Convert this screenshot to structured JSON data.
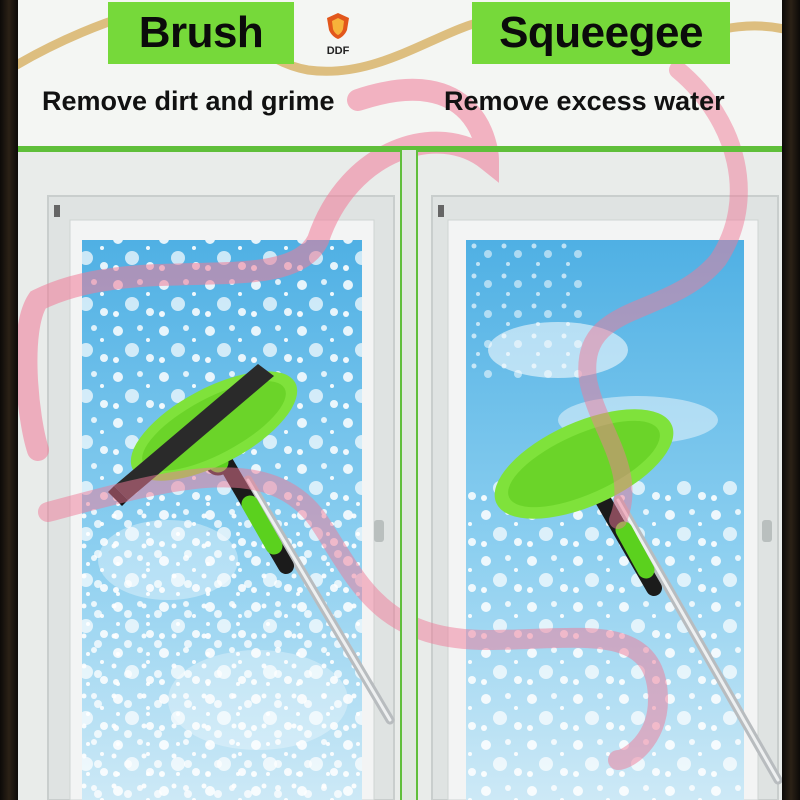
{
  "labels": {
    "left_title": "Brush",
    "right_title": "Squeegee",
    "left_caption": "Remove dirt and grime",
    "right_caption": "Remove excess water"
  },
  "logo": {
    "text": "DDF",
    "icon": "shield-logo-icon"
  },
  "colors": {
    "accent_green": "#76d93a",
    "handle_green": "#5bd11e",
    "ribbon_pink": "#f07a98",
    "ribbon_gold": "#d8b46a",
    "sky_blue": "#5fb8e6"
  }
}
